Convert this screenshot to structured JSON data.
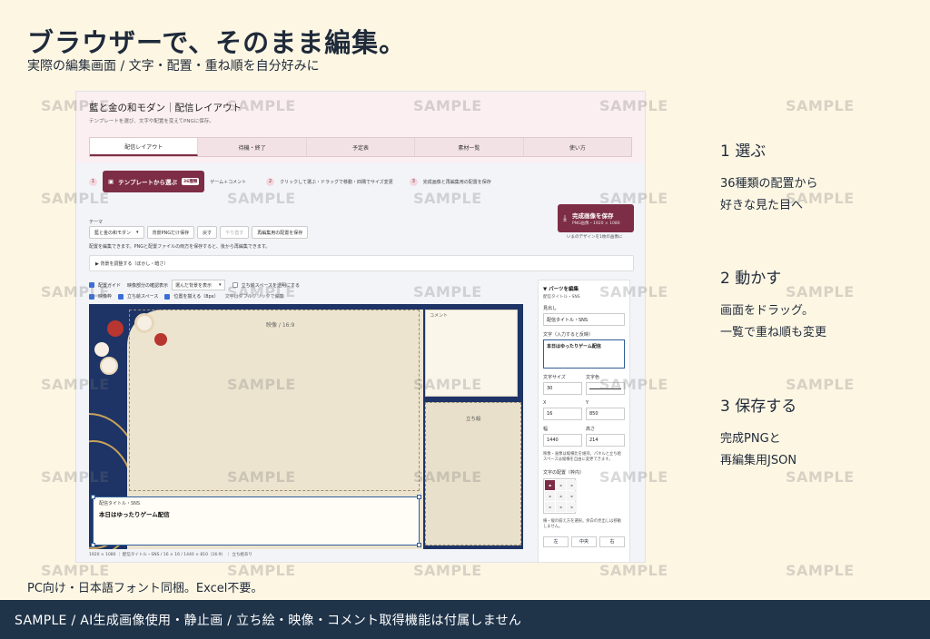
{
  "headline": "ブラウザーで、そのまま編集。",
  "subhead": "実際の編集画面 / 文字・配置・重ね順を自分好みに",
  "app": {
    "title": "藍と金の和モダン｜配信レイアウト",
    "subtitle": "テンプレートを選び、文字や配置を変えてPNGに保存。",
    "tabs": [
      "配信レイアウト",
      "待機・終了",
      "予定表",
      "素材一覧",
      "使い方"
    ],
    "steps": {
      "s1": "1",
      "template_button": "テンプレートから選ぶ",
      "template_badge": "36種類",
      "game_comment": "ゲーム＋コメント",
      "s2": "2",
      "s2_text": "クリックして選ぶ・ドラッグで移動・四隅でサイズ変更",
      "s3": "3",
      "s3_text": "完成画像と再編集用の配置を保存"
    },
    "save": {
      "label": "完成画像を保存",
      "size": "PNG画像・1920 × 1080",
      "note": "いまのデザインを1枚の画像に"
    },
    "theme": {
      "label": "テーマ",
      "select": "藍と金の和モダン",
      "buttons": [
        "背景PNGだけ保存",
        "戻す",
        "やり直す",
        "再編集用の配置を保存"
      ]
    },
    "hint": "配置を編集できます。PNGと配置ファイルの両方を保存すると、後から再編集できます。",
    "bg_adjust": "▶ 背景を調整する（ぼかし・暗さ）",
    "options_row1": {
      "guide": "配置ガイド",
      "preview_label": "映像部分の確認表示",
      "preview_select": "選んだ背景を表示",
      "transparent": "立ち絵スペースを透明にする"
    },
    "options_row2": {
      "video": "映像枠",
      "stand": "立ち絵スペース",
      "snap": "位置を揃える（8px）",
      "dblclick": "文字はダブルクリックで編集"
    },
    "canvas": {
      "video_label": "映像 / 16:9",
      "comment_label": "コメント",
      "stand_label": "立ち絵",
      "title_tag": "配信タイトル・SNS",
      "title_text": "本日はゆったりゲーム配信"
    },
    "status": "1920 × 1080 ｜ 配信タイトル・SNS / 16 × 16 / 1440 × 810（16:9） ｜ 立ち絵あり",
    "panel": {
      "header": "▼ パーツを編集",
      "selected": "配信タイトル・SNS",
      "heading_label": "見出し",
      "heading_value": "配信タイトル・SNS",
      "text_label": "文字（入力すると反映）",
      "text_value": "本日はゆったりゲーム配信",
      "font_size_label": "文字サイズ",
      "font_size_value": "30",
      "color_label": "文字色",
      "x_label": "X",
      "x_value": "16",
      "y_label": "Y",
      "y_value": "850",
      "w_label": "幅",
      "w_value": "1440",
      "h_label": "高さ",
      "h_value": "214",
      "note1": "映像・画像は縦横比を維持。パネルと立ち絵スペースは縦横を自由に変更できます。",
      "align_label": "文字の配置（枠内）",
      "note2": "横・縦の揃え方を選択。余白の見出しは移動しません。",
      "align_buttons": [
        "左",
        "中央",
        "右"
      ]
    }
  },
  "watermark": "SAMPLE",
  "features": [
    {
      "heading": "1  選ぶ",
      "lines": [
        "36種類の配置から",
        "好きな見た目へ"
      ]
    },
    {
      "heading": "2  動かす",
      "lines": [
        "画面をドラッグ。",
        "一覧で重ね順も変更"
      ]
    },
    {
      "heading": "3  保存する",
      "lines": [
        "完成PNGと",
        "再編集用JSON"
      ]
    }
  ],
  "footnote": "PC向け・日本語フォント同梱。Excel不要。",
  "footer": "SAMPLE / AI生成画像使用・静止画 / 立ち絵・映像・コメント取得機能は付属しません"
}
